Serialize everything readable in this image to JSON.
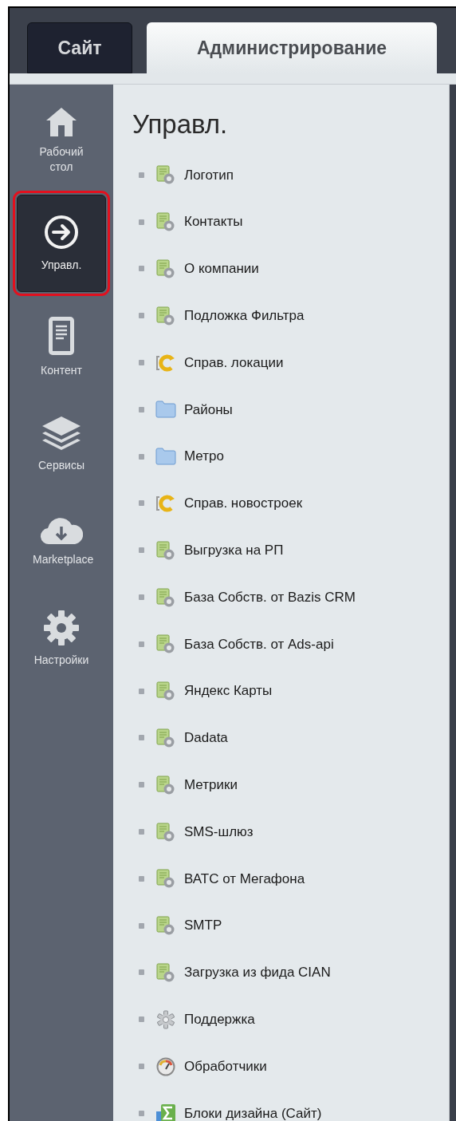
{
  "tabs": [
    {
      "label": "Сайт",
      "selected": false
    },
    {
      "label": "Администрирование",
      "selected": true
    }
  ],
  "sidebar": {
    "items": [
      {
        "kind": "home",
        "label": "Рабочий стол",
        "selected": false
      },
      {
        "kind": "arrow",
        "label": "Управл.",
        "selected": true
      },
      {
        "kind": "document",
        "label": "Контент",
        "selected": false
      },
      {
        "kind": "layers",
        "label": "Сервисы",
        "selected": false
      },
      {
        "kind": "cloud",
        "label": "Marketplace",
        "selected": false
      },
      {
        "kind": "gear",
        "label": "Настройки",
        "selected": false
      }
    ]
  },
  "content": {
    "title": "Управл.",
    "items": [
      {
        "kind": "settings-doc",
        "label": "Логотип"
      },
      {
        "kind": "settings-doc",
        "label": "Контакты"
      },
      {
        "kind": "settings-doc",
        "label": "О компании"
      },
      {
        "kind": "settings-doc",
        "label": "Подложка Фильтра"
      },
      {
        "kind": "module",
        "label": "Справ. локации"
      },
      {
        "kind": "folder",
        "label": "Районы"
      },
      {
        "kind": "folder",
        "label": "Метро"
      },
      {
        "kind": "module",
        "label": "Справ. новостроек"
      },
      {
        "kind": "settings-doc",
        "label": "Выгрузка на РП"
      },
      {
        "kind": "settings-doc",
        "label": "База Собств. от Bazis CRM"
      },
      {
        "kind": "settings-doc",
        "label": "База Собств. от Ads-api"
      },
      {
        "kind": "settings-doc",
        "label": "Яндекс Карты"
      },
      {
        "kind": "settings-doc",
        "label": "Dadata"
      },
      {
        "kind": "settings-doc",
        "label": "Метрики"
      },
      {
        "kind": "settings-doc",
        "label": "SMS-шлюз"
      },
      {
        "kind": "settings-doc",
        "label": "ВАТС от Мегафона"
      },
      {
        "kind": "settings-doc",
        "label": "SMTP"
      },
      {
        "kind": "settings-doc",
        "label": "Загрузка из фида CIAN"
      },
      {
        "kind": "gear",
        "label": "Поддержка"
      },
      {
        "kind": "gauge",
        "label": "Обработчики"
      },
      {
        "kind": "sigma",
        "label": "Блоки дизайна (Сайт)"
      }
    ]
  }
}
